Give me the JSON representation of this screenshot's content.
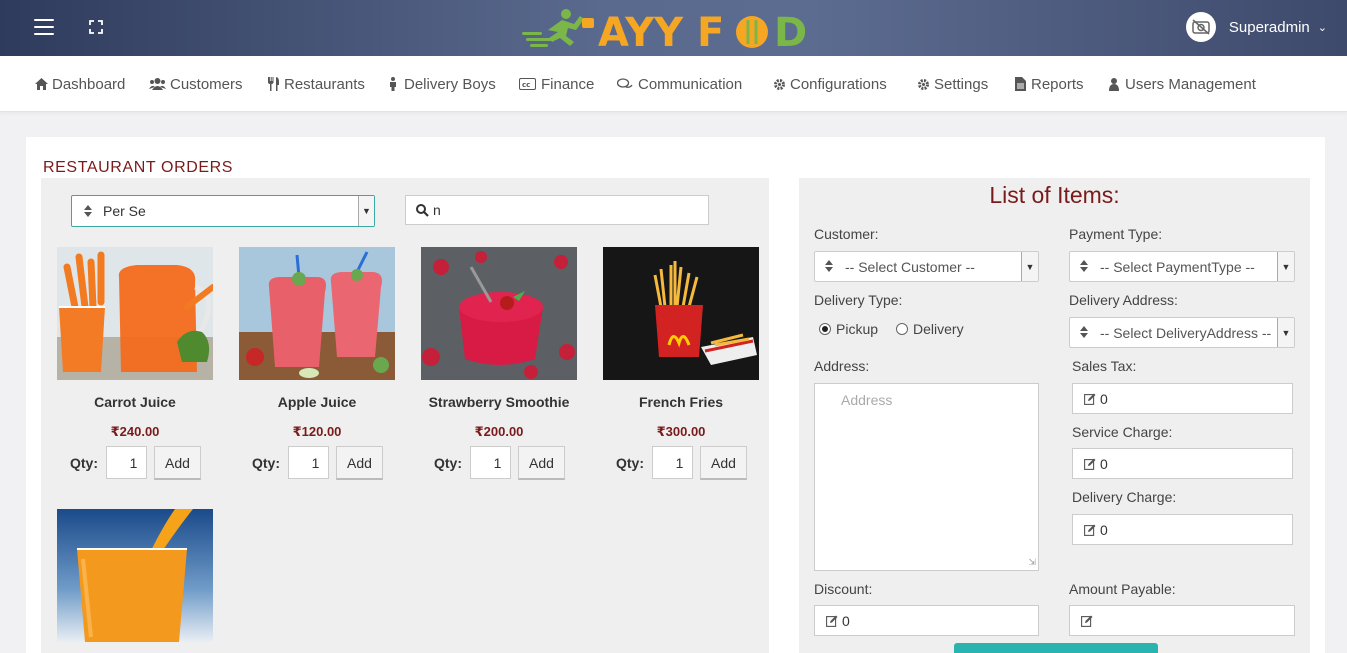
{
  "header": {
    "brand": "AYY FOOD",
    "user_name": "Superadmin"
  },
  "nav": [
    {
      "label": "Dashboard",
      "icon": "home-icon"
    },
    {
      "label": "Customers",
      "icon": "users-icon"
    },
    {
      "label": "Restaurants",
      "icon": "cutlery-icon"
    },
    {
      "label": "Delivery Boys",
      "icon": "person-icon"
    },
    {
      "label": "Finance",
      "icon": "cc-icon"
    },
    {
      "label": "Communication",
      "icon": "comments-icon"
    },
    {
      "label": "Configurations",
      "icon": "cog-icon"
    },
    {
      "label": "Settings",
      "icon": "cog-icon"
    },
    {
      "label": "Reports",
      "icon": "file-icon"
    },
    {
      "label": "Users Management",
      "icon": "user-icon"
    }
  ],
  "page": {
    "title": "RESTAURANT ORDERS",
    "restaurant_select": "Per Se",
    "search_value": "n"
  },
  "products": [
    {
      "name": "Carrot Juice",
      "price": "₹240.00",
      "qty": "1"
    },
    {
      "name": "Apple Juice",
      "price": "₹120.00",
      "qty": "1"
    },
    {
      "name": "Strawberry Smoothie",
      "price": "₹200.00",
      "qty": "1"
    },
    {
      "name": "French Fries",
      "price": "₹300.00",
      "qty": "1"
    },
    {
      "name": "",
      "price": "",
      "qty": ""
    }
  ],
  "product_labels": {
    "qty": "Qty:",
    "add": "Add"
  },
  "order_form": {
    "title": "List of Items:",
    "customer_label": "Customer:",
    "customer_value": "-- Select Customer --",
    "payment_label": "Payment Type:",
    "payment_value": "-- Select PaymentType --",
    "delivery_type_label": "Delivery Type:",
    "pickup_label": "Pickup",
    "delivery_label": "Delivery",
    "delivery_address_label": "Delivery Address:",
    "delivery_address_value": "-- Select DeliveryAddress --",
    "address_label": "Address:",
    "address_placeholder": "Address",
    "sales_tax_label": "Sales Tax:",
    "sales_tax_value": "0",
    "service_charge_label": "Service Charge:",
    "service_charge_value": "0",
    "delivery_charge_label": "Delivery Charge:",
    "delivery_charge_value": "0",
    "discount_label": "Discount:",
    "discount_value": "0",
    "amount_payable_label": "Amount Payable:",
    "amount_payable_value": ""
  },
  "colors": {
    "accent": "#7a1b1b",
    "teal": "#2bb3b0",
    "header_dark": "#2f3b5c"
  }
}
